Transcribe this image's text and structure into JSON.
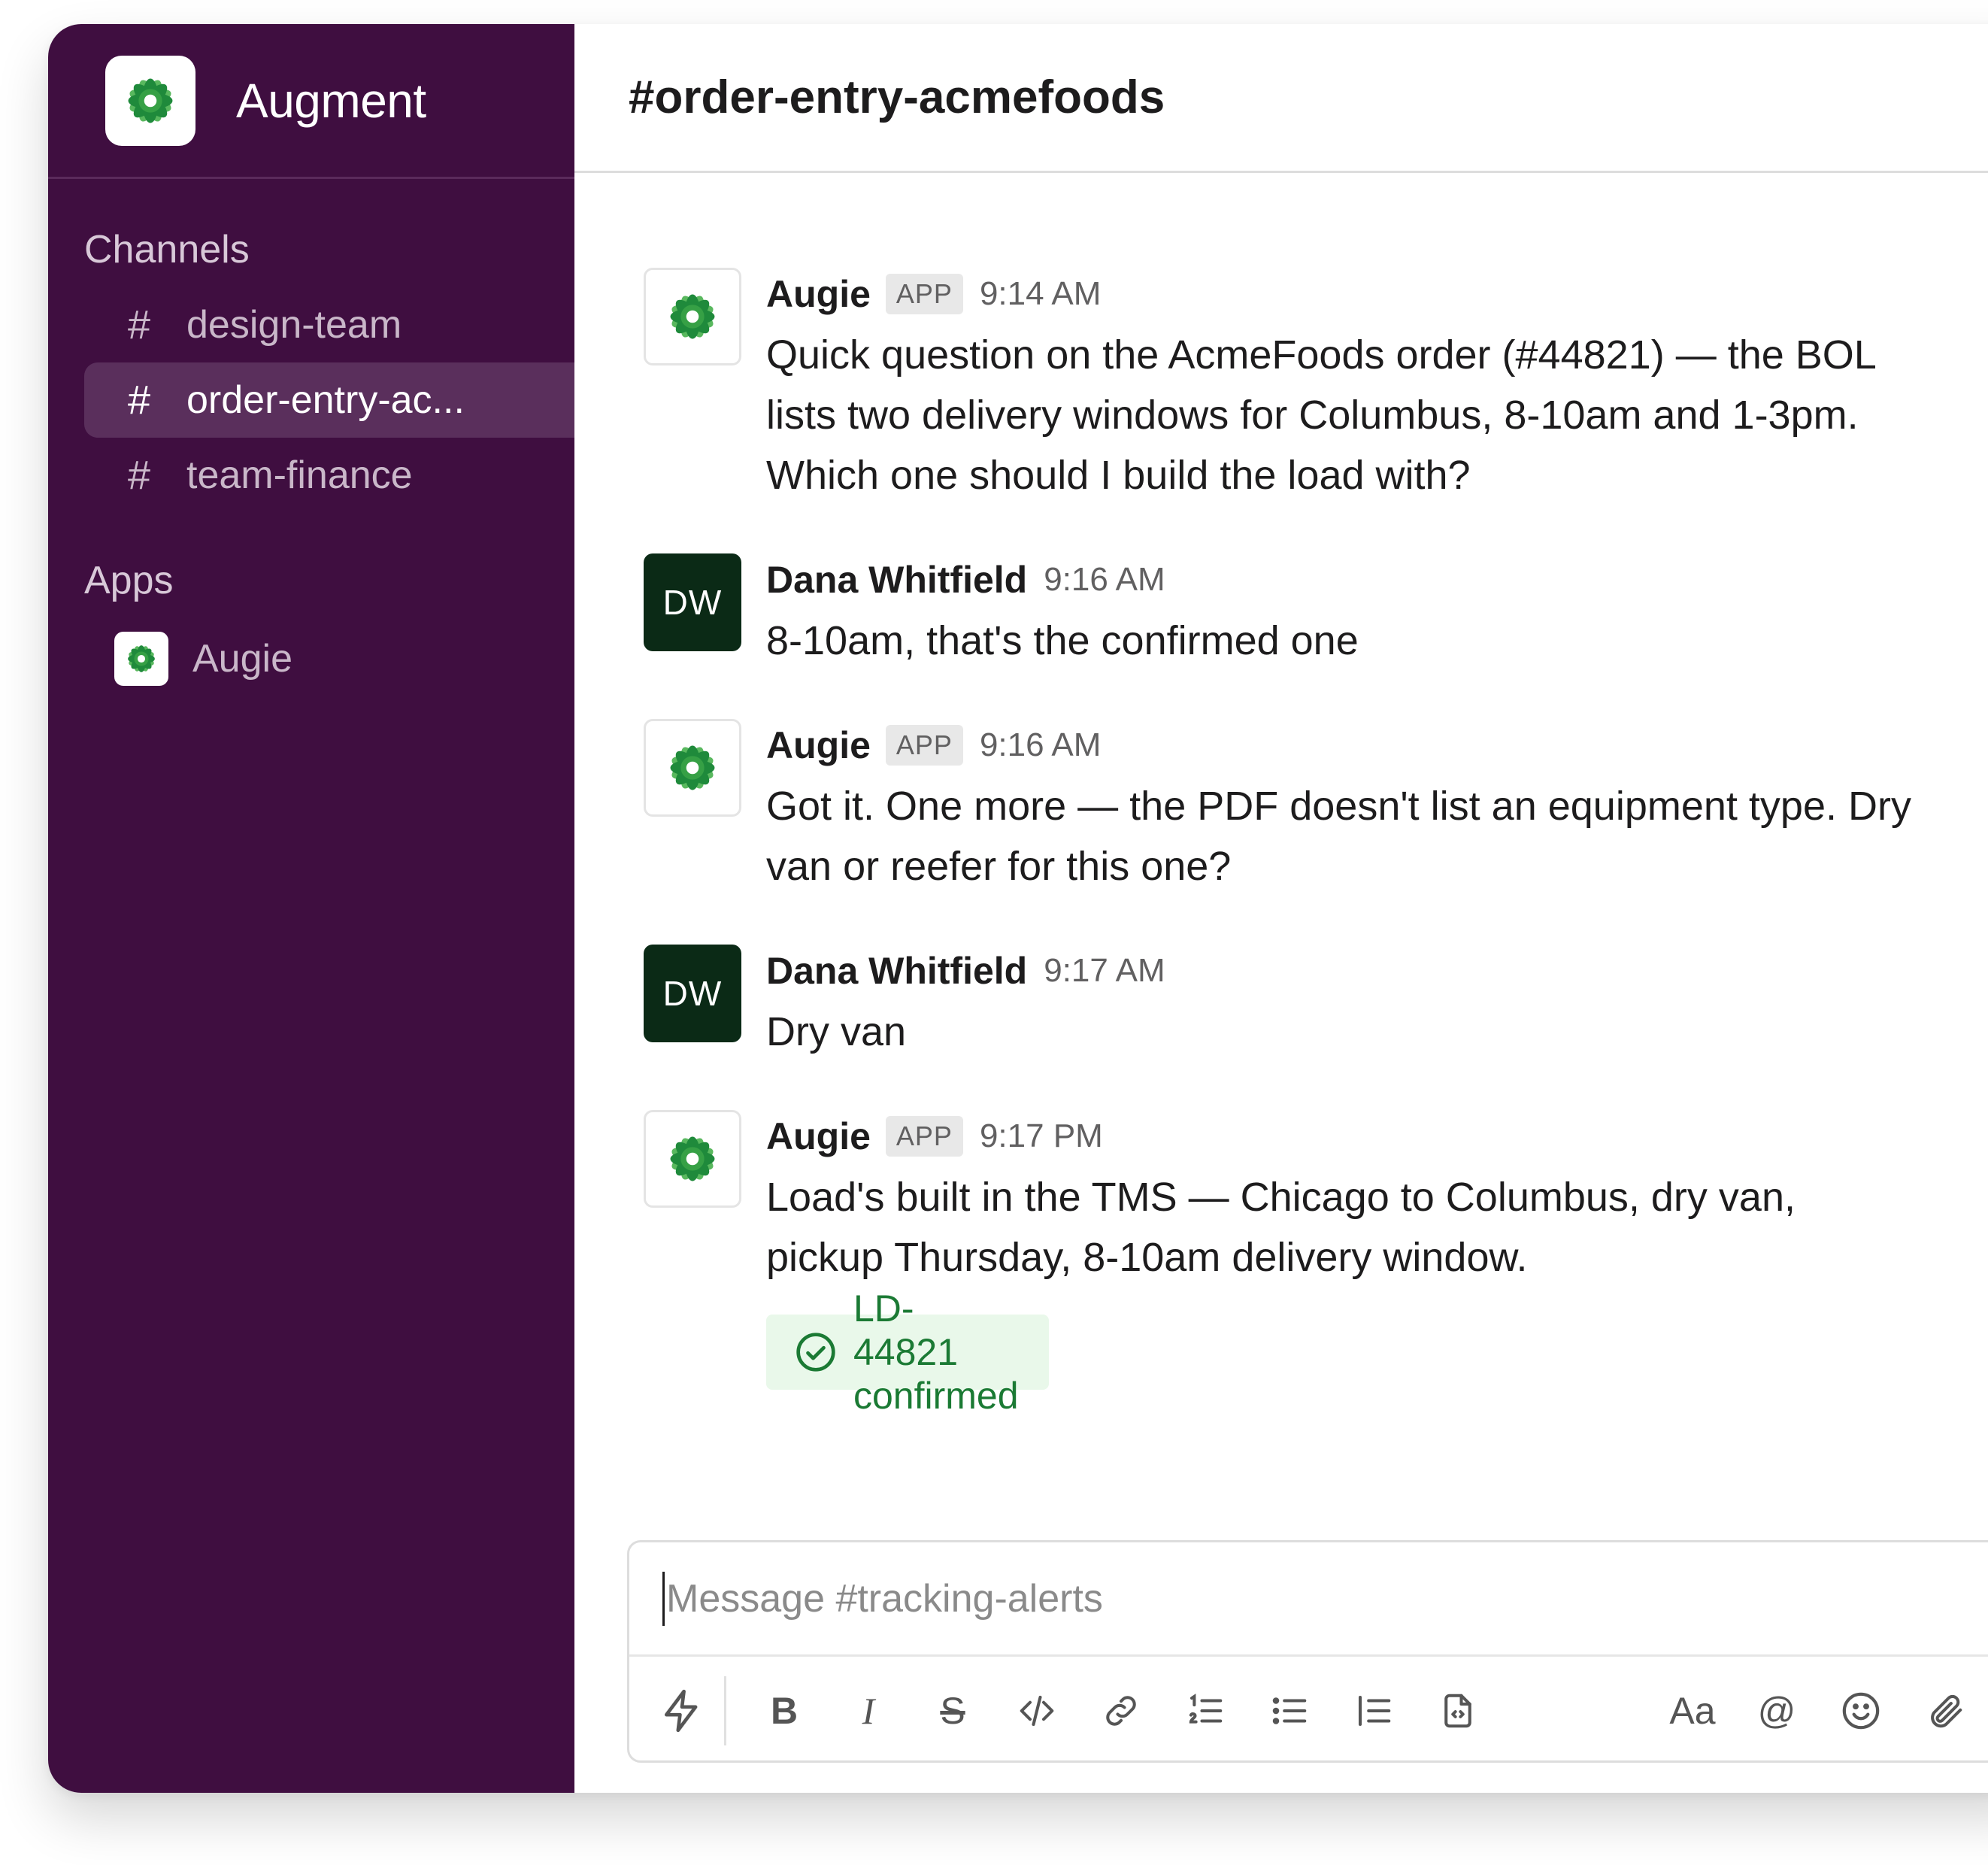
{
  "workspace": {
    "name": "Augment"
  },
  "sidebar": {
    "channels_title": "Channels",
    "channels": [
      {
        "label": "design-team",
        "active": false
      },
      {
        "label": "order-entry-ac...",
        "active": true
      },
      {
        "label": "team-finance",
        "active": false
      }
    ],
    "apps_title": "Apps",
    "apps": [
      {
        "label": "Augie",
        "icon": "flower-icon"
      }
    ],
    "hash_symbol": "#"
  },
  "header": {
    "channel_name": "#order-entry-acmefoods"
  },
  "messages": [
    {
      "author": "Augie",
      "is_app": true,
      "badge": "APP",
      "time": "9:14 AM",
      "text": "Quick question on the AcmeFoods order (#44821) — the BOL lists two delivery windows for Columbus, 8-10am and 1-3pm. Which one should I build the load with?"
    },
    {
      "author": "Dana Whitfield",
      "is_app": false,
      "initials": "DW",
      "time": "9:16 AM",
      "text": "8-10am, that's the confirmed one"
    },
    {
      "author": "Augie",
      "is_app": true,
      "badge": "APP",
      "time": "9:16 AM",
      "text": "Got it. One more — the PDF doesn't list an equipment type. Dry van or reefer for this one?"
    },
    {
      "author": "Dana Whitfield",
      "is_app": false,
      "initials": "DW",
      "time": "9:17 AM",
      "text": "Dry van"
    },
    {
      "author": "Augie",
      "is_app": true,
      "badge": "APP",
      "time": "9:17 PM",
      "text": "Load's built in the TMS — Chicago to Columbus, dry van, pickup Thursday, 8-10am delivery window.",
      "chip": {
        "label": "LD-44821 confirmed",
        "icon": "check-circle-icon"
      }
    }
  ],
  "composer": {
    "placeholder": "Message #tracking-alerts",
    "tools": {
      "shortcuts": "lightning-icon",
      "bold": "B",
      "italic": "I",
      "strike": "S",
      "code": "code-icon",
      "link": "link-icon",
      "ordered_list": "ordered-list-icon",
      "bulleted_list": "bulleted-list-icon",
      "blockquote": "blockquote-icon",
      "code_block": "code-block-icon",
      "format": "Aa",
      "mention": "@",
      "emoji": "emoji-icon",
      "attach": "paperclip-icon"
    }
  },
  "colors": {
    "sidebar_bg": "#3f0e40",
    "active_channel_bg": "#5a2f5c",
    "user_avatar_bg": "#0b2a16",
    "confirm_chip_bg": "#e9f8ea",
    "confirm_chip_text": "#1b7a34",
    "logo_green_dark": "#1f8a3b",
    "logo_green_light": "#59b85e"
  }
}
